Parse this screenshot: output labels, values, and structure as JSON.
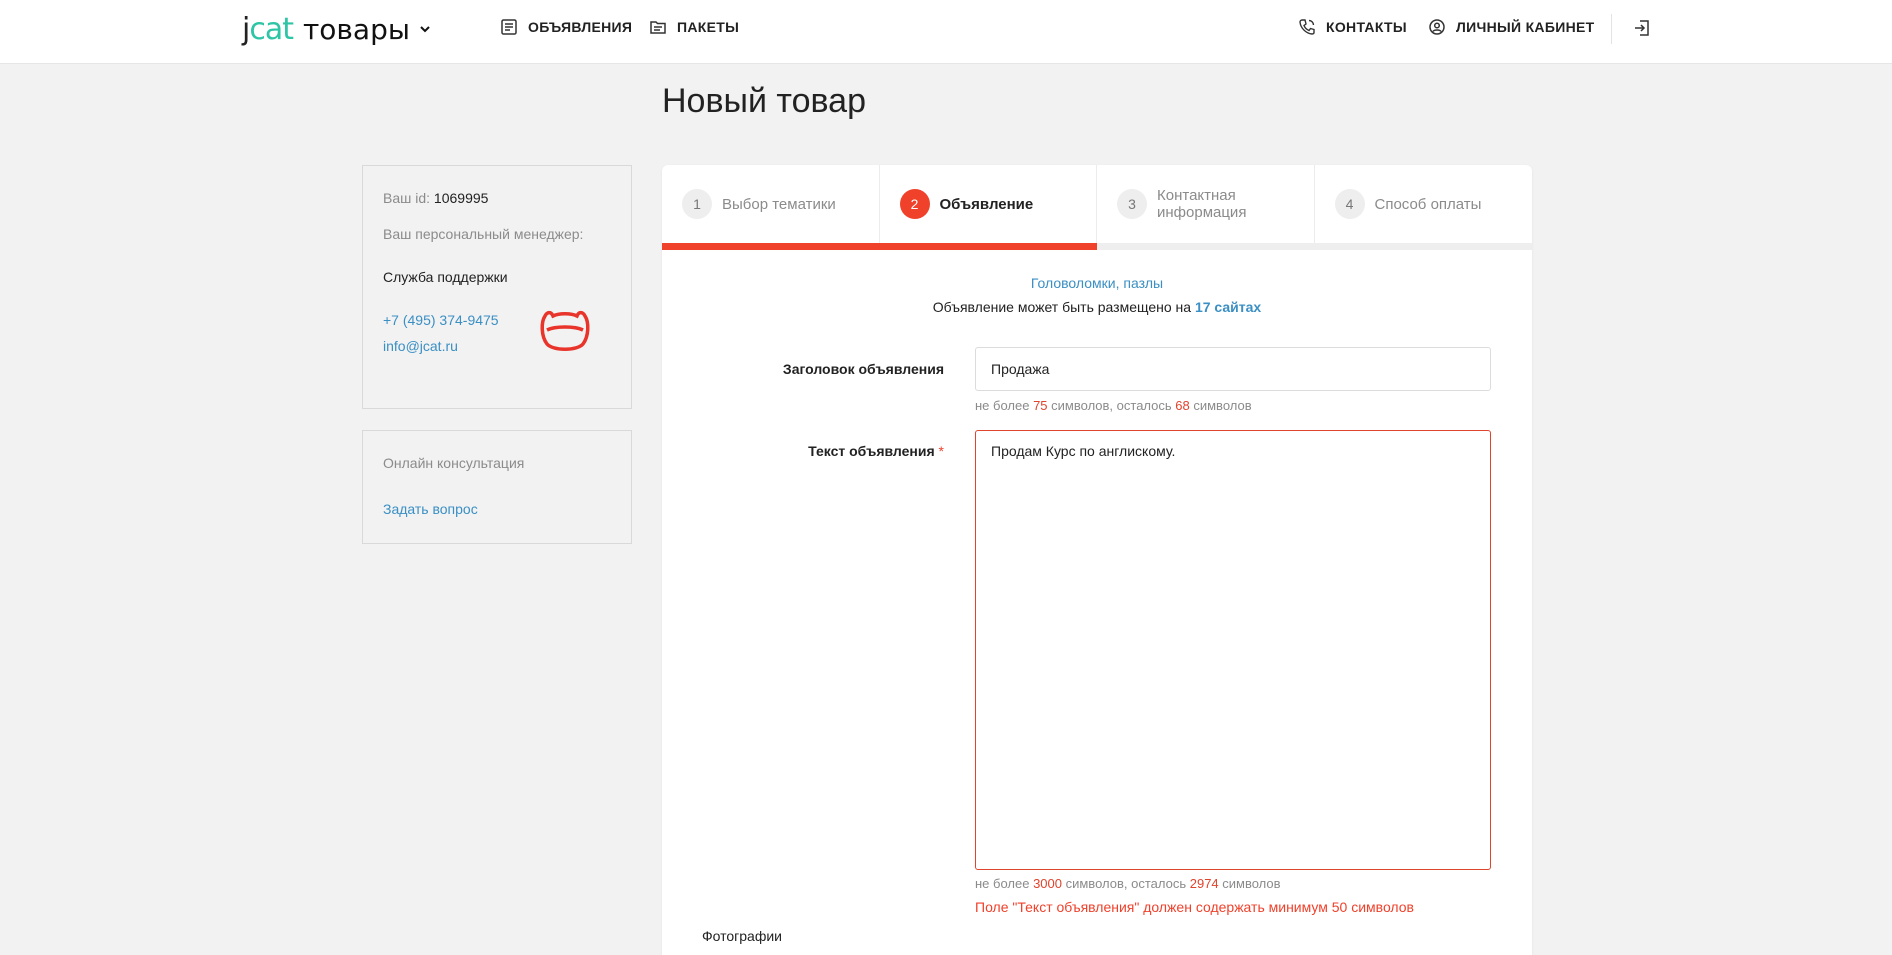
{
  "header": {
    "logo_j": "j",
    "logo_cat": "cat",
    "logo_text": "товары",
    "nav_ads": "ОБЪЯВЛЕНИЯ",
    "nav_packages": "ПАКЕТЫ",
    "nav_contacts": "КОНТАКТЫ",
    "nav_cabinet": "ЛИЧНЫЙ КАБИНЕТ"
  },
  "page": {
    "title": "Новый товар"
  },
  "sidebar": {
    "id_label": "Ваш id: ",
    "id_value": "1069995",
    "manager_label": "Ваш персональный менеджер:",
    "support": "Служба поддержки",
    "phone": "+7 (495) 374-9475",
    "email": "info@jcat.ru",
    "consult_title": "Онлайн консультация",
    "consult_link": "Задать вопрос"
  },
  "steps": [
    {
      "num": "1",
      "label": "Выбор тематики"
    },
    {
      "num": "2",
      "label": "Объявление"
    },
    {
      "num": "3",
      "label": "Контактная информация"
    },
    {
      "num": "4",
      "label": "Способ оплаты"
    }
  ],
  "progress": {
    "current_step": 2,
    "total_steps": 4,
    "fraction": 0.5
  },
  "form": {
    "category": "Головоломки, пазлы",
    "placed_prefix": "Объявление может быть размещено на ",
    "placed_link": "17 сайтах",
    "title_label": "Заголовок объявления",
    "title_value": "Продажа",
    "title_hint_a": "не более ",
    "title_max": "75",
    "title_hint_b": " символов, осталось ",
    "title_left": "68",
    "title_hint_c": " символов",
    "text_label": "Текст объявления",
    "required_mark": "*",
    "text_value": "Продам Курс по англискому.",
    "text_hint_a": "не более ",
    "text_max": "3000",
    "text_hint_b": " символов, осталось ",
    "text_left": "2974",
    "text_hint_c": " символов",
    "error": "Поле \"Текст объявления\" должен содержать минимум 50 символов",
    "photos_label": "Фотографии"
  },
  "colors": {
    "accent": "#f0412b",
    "link": "#3a8fc4",
    "brand_teal": "#2ec4a6"
  }
}
